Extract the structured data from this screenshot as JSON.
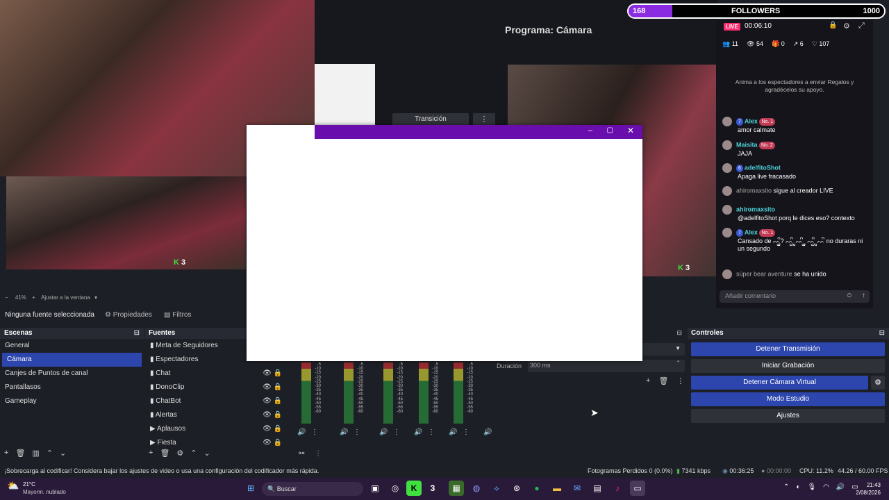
{
  "overlay": {
    "followers_count": "168",
    "followers_label": "FOLLOWERS",
    "followers_goal": "1000",
    "k_badge": "3"
  },
  "program_label": "Programa: Cámara",
  "preview_chip": "Transición",
  "tiktok_panel": {
    "live_badge": "LIVE",
    "timer": "00:06:10",
    "stats": {
      "viewers": "11",
      "views": "54",
      "gifts": "0",
      "shares": "6",
      "likes": "107"
    },
    "gift_prompt": "Anima a los espectadores a enviar Regalos y agradécelos su apoyo.",
    "comment_placeholder": "Añadir comentario",
    "messages": [
      {
        "badge1": "7",
        "user": "Alex",
        "badge2": "No. 1",
        "text": "amor calmate"
      },
      {
        "user": "Maisita",
        "badge2": "No. 2",
        "text": "JAJA"
      },
      {
        "badge1": "6",
        "user": "adelfitoShot",
        "text": "Apaga live fracasado"
      },
      {
        "user": "ahiromaxsito",
        "text": "sigue al creador LIVE"
      },
      {
        "user": "ahiromaxsito",
        "text": "@adelfitoShot porq le dices eso? contexto"
      },
      {
        "badge1": "7",
        "user": "Alex",
        "badge2": "No. 1",
        "text": "Cansado de ᨓᩚᩛᩜ? ᨓᩚᩛ ᩜᨓᩚ ᩛᩜ ᨓᩚᩛ ᩜᨓᩚ no duraras ni un segundo"
      },
      {
        "user": "súper bear aventure",
        "text": "se ha unido"
      }
    ]
  },
  "zoom_bar": {
    "zoom": "41%",
    "fit": "Ajustar a la ventana"
  },
  "source_toolbar": {
    "no_source": "Ninguna fuente seleccionada",
    "properties": "Propiedades",
    "filters": "Filtros"
  },
  "scenes": {
    "title": "Escenas",
    "items": [
      "General",
      "Cámara",
      "Canjes de Puntos de canal",
      "Pantallasos",
      "Gameplay"
    ],
    "selected": 1
  },
  "sources": {
    "title": "Fuentes",
    "items": [
      "Meta de Seguidores",
      "Espectadores",
      "Chat",
      "DonoClip",
      "ChatBot",
      "Alertas",
      "Aplausos",
      "Fiesta"
    ]
  },
  "mixer": {
    "ticks": [
      "-5",
      "-10",
      "-15",
      "-20",
      "-25",
      "-30",
      "-35",
      "-40",
      "-45",
      "-50",
      "-55",
      "-60"
    ]
  },
  "transitions": {
    "duration_label": "Duración",
    "duration_value": "300 ms"
  },
  "controls": {
    "title": "Controles",
    "buttons": [
      "Detener Transmisión",
      "Iniciar Grabación",
      "Detener Cámara Virtual",
      "Modo Estudio",
      "Ajustes"
    ]
  },
  "status_bar": {
    "warning": "¡Sobrecarga al codificar! Considera bajar los ajustes de video o usa una configuración del codificador más rápida.",
    "dropped": "Fotogramas Perdidos 0 (0.0%)",
    "bitrate": "7341 kbps",
    "stream_time": "00:36:25",
    "rec_time": "00:00:00",
    "cpu": "CPU: 11.2%",
    "fps": "44.26 / 60.00 FPS"
  },
  "taskbar": {
    "temp": "21°C",
    "weather": "Mayorm. nublado",
    "search": "Buscar",
    "time": "21:43",
    "date": "2/08/2026"
  },
  "colors": {
    "accent_blue": "#2c46ad",
    "tiktok_purple": "#6a0dad",
    "live_pink": "#ff2d6f"
  }
}
